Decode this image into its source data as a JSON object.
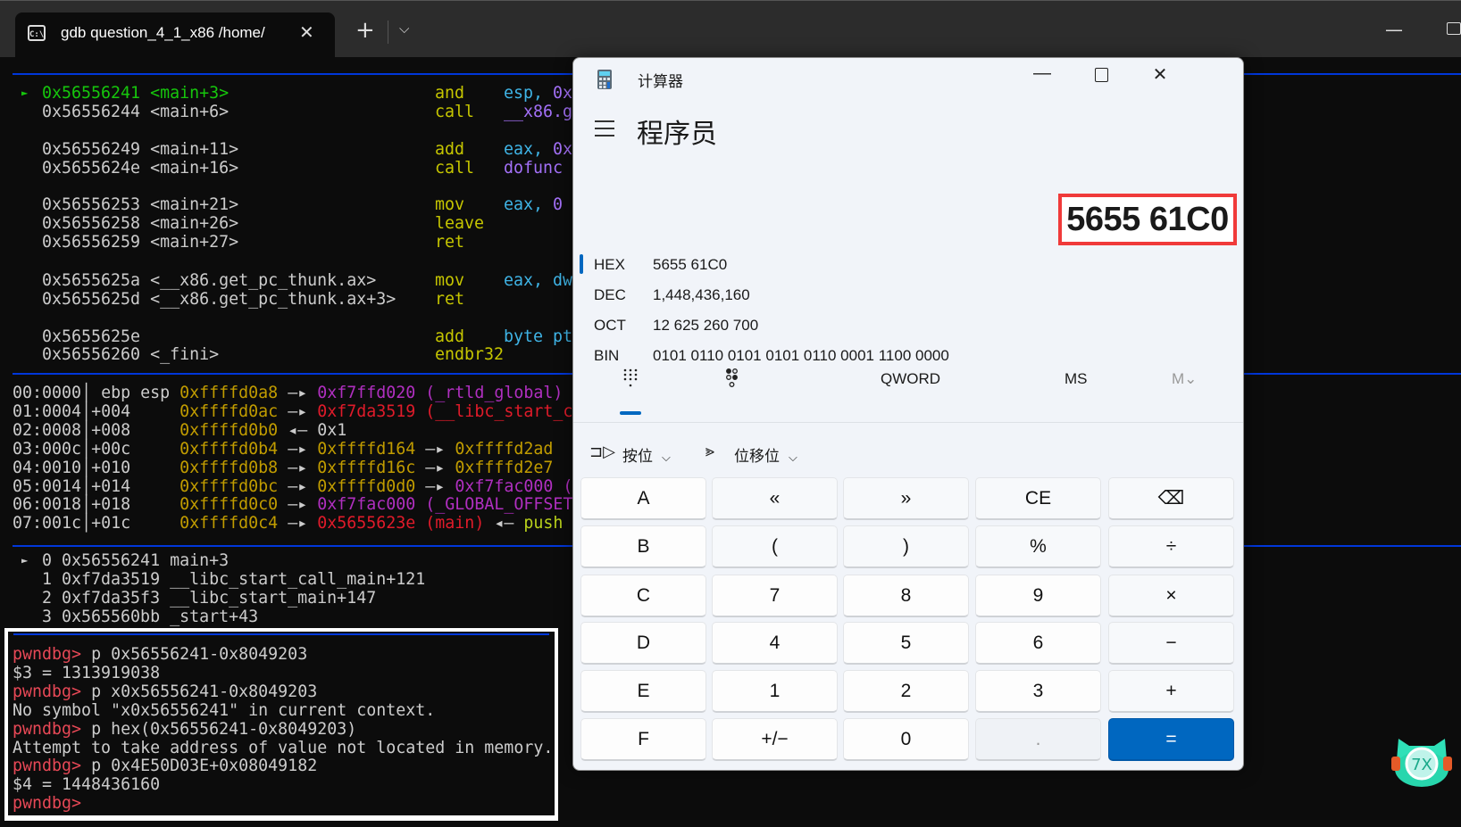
{
  "terminal": {
    "tab_title": "gdb question_4_1_x86 /home/",
    "tab_icon_text": "C:\\",
    "disasm": [
      {
        "marker": "►",
        "cols": [
          [
            {
              "t": "0x56556241 <main+3>",
              "c": "g"
            }
          ],
          [
            {
              "t": "and",
              "c": "y"
            }
          ],
          [
            {
              "t": "esp, ",
              "c": "cy"
            },
            {
              "t": "0x",
              "c": "p"
            }
          ]
        ]
      },
      {
        "cols": [
          [
            {
              "t": "0x56556244 <main+6>",
              "c": "w"
            }
          ],
          [
            {
              "t": "call",
              "c": "y"
            }
          ],
          [
            {
              "t": "__x86.g",
              "c": "p"
            }
          ]
        ]
      },
      {
        "cols": [
          [
            {
              "t": "0x56556249 <main+11>",
              "c": "w"
            }
          ],
          [
            {
              "t": "add",
              "c": "y"
            }
          ],
          [
            {
              "t": "eax, ",
              "c": "cy"
            },
            {
              "t": "0x",
              "c": "p"
            }
          ]
        ]
      },
      {
        "cols": [
          [
            {
              "t": "0x5655624e <main+16>",
              "c": "w"
            }
          ],
          [
            {
              "t": "call",
              "c": "y"
            }
          ],
          [
            {
              "t": "dofunc",
              "c": "p"
            }
          ]
        ]
      },
      {
        "cols": [
          [
            {
              "t": "0x56556253 <main+21>",
              "c": "w"
            }
          ],
          [
            {
              "t": "mov",
              "c": "y"
            }
          ],
          [
            {
              "t": "eax, ",
              "c": "cy"
            },
            {
              "t": "0",
              "c": "p"
            }
          ]
        ]
      },
      {
        "cols": [
          [
            {
              "t": "0x56556258 <main+26>",
              "c": "w"
            }
          ],
          [
            {
              "t": "leave",
              "c": "y"
            }
          ],
          []
        ]
      },
      {
        "cols": [
          [
            {
              "t": "0x56556259 <main+27>",
              "c": "w"
            }
          ],
          [
            {
              "t": "ret",
              "c": "y"
            }
          ],
          []
        ]
      },
      {
        "cols": [
          [
            {
              "t": "0x5655625a <__x86.get_pc_thunk.ax>",
              "c": "w"
            }
          ],
          [
            {
              "t": "mov",
              "c": "y"
            }
          ],
          [
            {
              "t": "eax, dw",
              "c": "cy"
            }
          ]
        ]
      },
      {
        "cols": [
          [
            {
              "t": "0x5655625d <__x86.get_pc_thunk.ax+3>",
              "c": "w"
            }
          ],
          [
            {
              "t": "ret",
              "c": "y"
            }
          ],
          []
        ]
      },
      {
        "cols": [
          [
            {
              "t": "0x5655625e",
              "c": "w"
            }
          ],
          [
            {
              "t": "add",
              "c": "y"
            }
          ],
          [
            {
              "t": "byte pt",
              "c": "cy"
            }
          ]
        ]
      },
      {
        "cols": [
          [
            {
              "t": "0x56556260 <_fini>",
              "c": "w"
            }
          ],
          [
            {
              "t": "endbr32",
              "c": "y"
            }
          ],
          []
        ]
      }
    ],
    "stack": [
      [
        {
          "t": "00:0000│ ",
          "c": "w"
        },
        {
          "t": "ebp esp ",
          "c": "w"
        },
        {
          "t": "0xffffd0a8",
          "c": "o"
        },
        {
          "t": " —▸ ",
          "c": "w"
        },
        {
          "t": "0xf7ffd020 (_rtld_global)",
          "c": "pm"
        }
      ],
      [
        {
          "t": "01:0004│",
          "c": "w"
        },
        {
          "t": "+004     ",
          "c": "w"
        },
        {
          "t": "0xffffd0ac",
          "c": "o"
        },
        {
          "t": " —▸ ",
          "c": "w"
        },
        {
          "t": "0xf7da3519 (__libc_start_c",
          "c": "r"
        }
      ],
      [
        {
          "t": "02:0008│",
          "c": "w"
        },
        {
          "t": "+008     ",
          "c": "w"
        },
        {
          "t": "0xffffd0b0",
          "c": "o"
        },
        {
          "t": " ◂— 0x1",
          "c": "w"
        }
      ],
      [
        {
          "t": "03:000c│",
          "c": "w"
        },
        {
          "t": "+00c     ",
          "c": "w"
        },
        {
          "t": "0xffffd0b4",
          "c": "o"
        },
        {
          "t": " —▸ ",
          "c": "w"
        },
        {
          "t": "0xffffd164",
          "c": "o"
        },
        {
          "t": " —▸ ",
          "c": "w"
        },
        {
          "t": "0xffffd2ad",
          "c": "o"
        }
      ],
      [
        {
          "t": "04:0010│",
          "c": "w"
        },
        {
          "t": "+010     ",
          "c": "w"
        },
        {
          "t": "0xffffd0b8",
          "c": "o"
        },
        {
          "t": " —▸ ",
          "c": "w"
        },
        {
          "t": "0xffffd16c",
          "c": "o"
        },
        {
          "t": " —▸ ",
          "c": "w"
        },
        {
          "t": "0xffffd2e7",
          "c": "o"
        }
      ],
      [
        {
          "t": "05:0014│",
          "c": "w"
        },
        {
          "t": "+014     ",
          "c": "w"
        },
        {
          "t": "0xffffd0bc",
          "c": "o"
        },
        {
          "t": " —▸ ",
          "c": "w"
        },
        {
          "t": "0xffffd0d0",
          "c": "o"
        },
        {
          "t": " —▸ ",
          "c": "w"
        },
        {
          "t": "0xf7fac000 (",
          "c": "pm"
        }
      ],
      [
        {
          "t": "06:0018│",
          "c": "w"
        },
        {
          "t": "+018     ",
          "c": "w"
        },
        {
          "t": "0xffffd0c0",
          "c": "o"
        },
        {
          "t": " —▸ ",
          "c": "w"
        },
        {
          "t": "0xf7fac000 (_GLOBAL_OFFSET",
          "c": "pm"
        }
      ],
      [
        {
          "t": "07:001c│",
          "c": "w"
        },
        {
          "t": "+01c     ",
          "c": "w"
        },
        {
          "t": "0xffffd0c4",
          "c": "o"
        },
        {
          "t": " —▸ ",
          "c": "w"
        },
        {
          "t": "0x5655623e (main)",
          "c": "r"
        },
        {
          "t": " ◂— ",
          "c": "w"
        },
        {
          "t": "push",
          "c": "yg"
        }
      ]
    ],
    "backtrace": [
      {
        "marker": "►",
        "t": "0 0x56556241 main+3"
      },
      {
        "t": "1 0xf7da3519 __libc_start_call_main+121"
      },
      {
        "t": "2 0xf7da35f3 __libc_start_main+147"
      },
      {
        "t": "3 0x565560bb _start+43"
      }
    ],
    "console": [
      [
        {
          "t": "pwndbg> ",
          "c": "pr"
        },
        {
          "t": "p 0x56556241-0x8049203",
          "c": "w"
        }
      ],
      [
        {
          "t": "$3 = 1313919038",
          "c": "w"
        }
      ],
      [
        {
          "t": "pwndbg> ",
          "c": "pr"
        },
        {
          "t": "p x0x56556241-0x8049203",
          "c": "w"
        }
      ],
      [
        {
          "t": "No symbol \"x0x56556241\" in current context.",
          "c": "w"
        }
      ],
      [
        {
          "t": "pwndbg> ",
          "c": "pr"
        },
        {
          "t": "p hex(0x56556241-0x8049203)",
          "c": "w"
        }
      ],
      [
        {
          "t": "Attempt to take address of value not located in memory.",
          "c": "w"
        }
      ],
      [
        {
          "t": "pwndbg> ",
          "c": "pr"
        },
        {
          "t": "p 0x4E50D03E+0x08049182",
          "c": "w"
        }
      ],
      [
        {
          "t": "$4 = 1448436160",
          "c": "w"
        }
      ],
      [
        {
          "t": "pwndbg>",
          "c": "pr"
        }
      ]
    ]
  },
  "calculator": {
    "title": "计算器",
    "mode": "程序员",
    "display": "5655 61C0",
    "radix": [
      {
        "label": "HEX",
        "value": "5655 61C0",
        "active": true
      },
      {
        "label": "DEC",
        "value": "1,448,436,160"
      },
      {
        "label": "OCT",
        "value": "12 625 260 700"
      },
      {
        "label": "BIN",
        "value": "0101 0110 0101 0101 0110 0001 1100 0000"
      }
    ],
    "word_size": "QWORD",
    "memory_store": "MS",
    "memory_menu": "M⌄",
    "bitwise": "按位",
    "bitshift": "位移位",
    "accent": "#0067c0",
    "highlight_box_color": "#f03a3a",
    "buttons": [
      {
        "l": "A",
        "k": "hex"
      },
      {
        "l": "«",
        "k": "op"
      },
      {
        "l": "»",
        "k": "op"
      },
      {
        "l": "CE",
        "k": "op"
      },
      {
        "l": "⌫",
        "k": "op",
        "icon": "backspace-icon"
      },
      {
        "l": "B",
        "k": "hex"
      },
      {
        "l": "(",
        "k": "op"
      },
      {
        "l": ")",
        "k": "op"
      },
      {
        "l": "%",
        "k": "op"
      },
      {
        "l": "÷",
        "k": "op"
      },
      {
        "l": "C",
        "k": "hex"
      },
      {
        "l": "7",
        "k": "num"
      },
      {
        "l": "8",
        "k": "num"
      },
      {
        "l": "9",
        "k": "num"
      },
      {
        "l": "×",
        "k": "op"
      },
      {
        "l": "D",
        "k": "hex"
      },
      {
        "l": "4",
        "k": "num"
      },
      {
        "l": "5",
        "k": "num"
      },
      {
        "l": "6",
        "k": "num"
      },
      {
        "l": "−",
        "k": "op"
      },
      {
        "l": "E",
        "k": "hex"
      },
      {
        "l": "1",
        "k": "num"
      },
      {
        "l": "2",
        "k": "num"
      },
      {
        "l": "3",
        "k": "num"
      },
      {
        "l": "+",
        "k": "op"
      },
      {
        "l": "F",
        "k": "hex"
      },
      {
        "l": "+/−",
        "k": "num"
      },
      {
        "l": "0",
        "k": "num"
      },
      {
        "l": ".",
        "k": "dis"
      },
      {
        "l": "=",
        "k": "eq"
      }
    ]
  }
}
